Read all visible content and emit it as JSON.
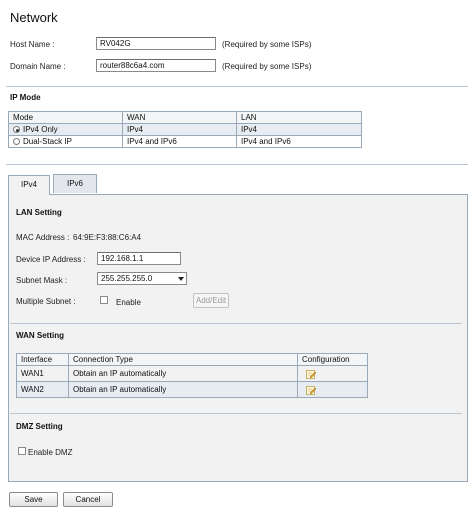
{
  "page_title": "Network",
  "host_name": {
    "label": "Host Name :",
    "value": "RV042G",
    "hint": "(Required by some ISPs)"
  },
  "domain_name": {
    "label": "Domain Name :",
    "value": "router88c6a4.com",
    "hint": "(Required by some ISPs)"
  },
  "ip_mode": {
    "title": "IP Mode",
    "headers": [
      "Mode",
      "WAN",
      "LAN"
    ],
    "rows": [
      {
        "mode": "IPv4 Only",
        "wan": "IPv4",
        "lan": "IPv4",
        "selected": true
      },
      {
        "mode": "Dual-Stack IP",
        "wan": "IPv4 and IPv6",
        "lan": "IPv4 and IPv6",
        "selected": false
      }
    ]
  },
  "tabs": [
    {
      "label": "IPv4",
      "active": true
    },
    {
      "label": "IPv6",
      "active": false
    }
  ],
  "lan_setting": {
    "title": "LAN Setting",
    "mac_label": "MAC Address :",
    "mac_value": "64:9E:F3:88:C6:A4",
    "device_ip_label": "Device IP Address :",
    "device_ip_value": "192.168.1.1",
    "subnet_label": "Subnet Mask :",
    "subnet_value": "255.255.255.0",
    "multiple_subnet_label": "Multiple Subnet :",
    "enable_label": "Enable",
    "add_edit_label": "Add/Edit"
  },
  "wan_setting": {
    "title": "WAN Setting",
    "headers": [
      "Interface",
      "Connection Type",
      "Configuration"
    ],
    "rows": [
      {
        "interface": "WAN1",
        "connection": "Obtain an IP automatically",
        "config_icon": "edit-icon"
      },
      {
        "interface": "WAN2",
        "connection": "Obtain an IP automatically",
        "config_icon": "edit-icon"
      }
    ]
  },
  "dmz_setting": {
    "title": "DMZ Setting",
    "enable_label": "Enable DMZ"
  },
  "buttons": {
    "save": "Save",
    "cancel": "Cancel"
  }
}
